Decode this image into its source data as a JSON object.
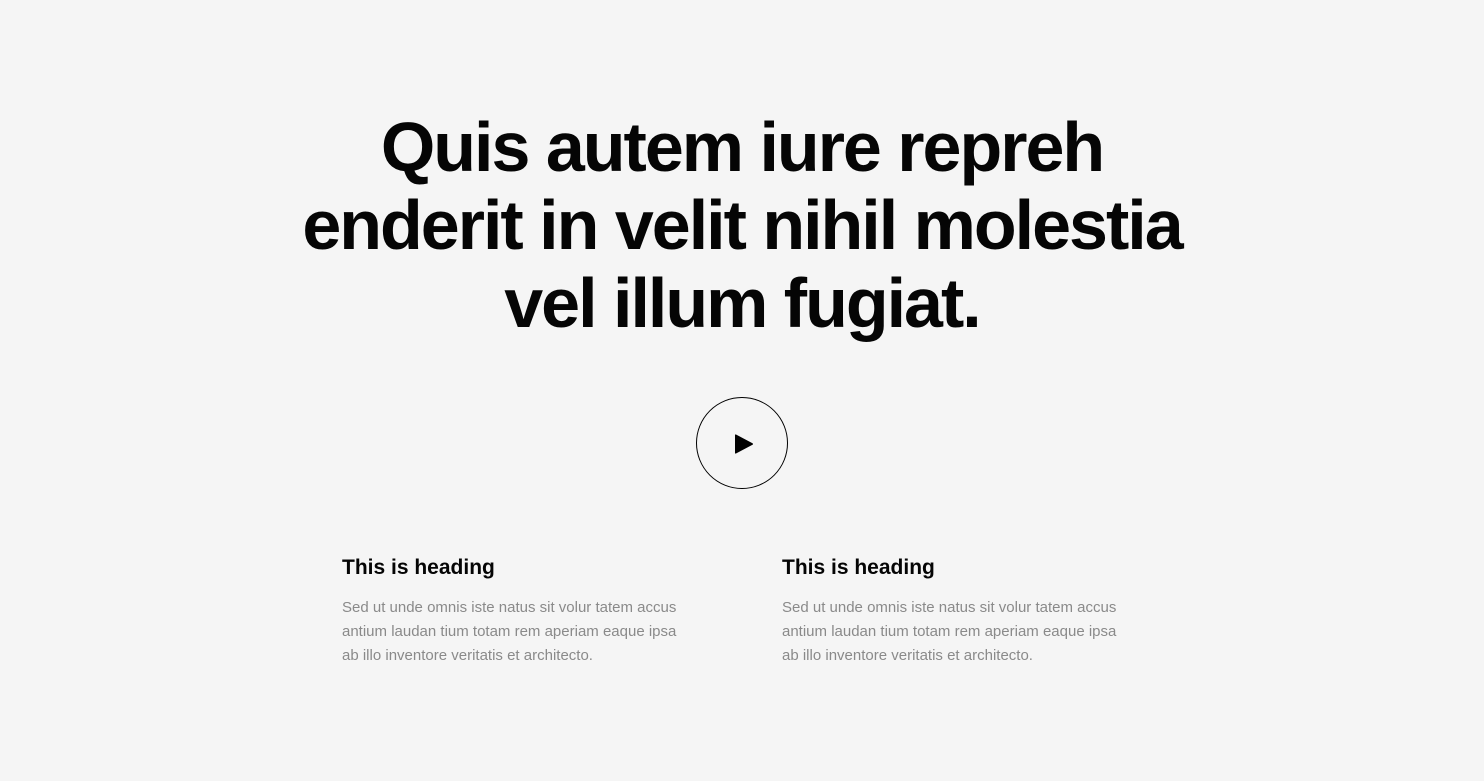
{
  "hero": {
    "title_lines": [
      "Quis autem iure repreh",
      "enderit in velit nihil molestia",
      "vel illum fugiat."
    ]
  },
  "video": {
    "play_icon": "play-icon"
  },
  "features": [
    {
      "heading": "This is heading",
      "text_lines": [
        "Sed ut unde omnis iste natus sit volur tatem accus",
        "antium laudan tium totam rem aperiam eaque ipsa",
        "ab illo inventore veritatis et architecto."
      ]
    },
    {
      "heading": "This is heading",
      "text_lines": [
        "Sed ut unde omnis iste natus sit volur tatem accus",
        "antium laudan tium totam rem aperiam eaque ipsa",
        "ab illo inventore veritatis et architecto."
      ]
    }
  ],
  "colors": {
    "background": "#f5f5f5",
    "text": "#050505",
    "muted_text": "#8a8a8a"
  }
}
